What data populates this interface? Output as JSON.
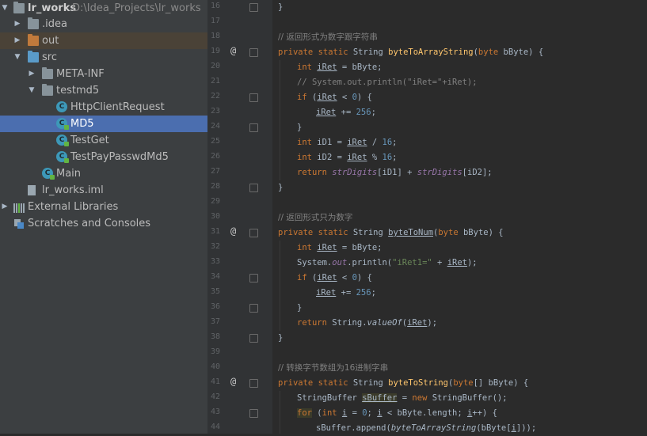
{
  "project_tree": {
    "root": {
      "name": "lr_works",
      "path": "D:\\Idea_Projects\\lr_works"
    },
    "items": [
      {
        "label": "lr_works",
        "extra": "D:\\Idea_Projects\\lr_works",
        "type": "project"
      },
      {
        "label": ".idea",
        "type": "folder"
      },
      {
        "label": "out",
        "type": "folder-orange"
      },
      {
        "label": "src",
        "type": "folder-blue"
      },
      {
        "label": "META-INF",
        "type": "folder"
      },
      {
        "label": "testmd5",
        "type": "package"
      },
      {
        "label": "HttpClientRequest",
        "type": "class"
      },
      {
        "label": "MD5",
        "type": "class",
        "selected": true
      },
      {
        "label": "TestGet",
        "type": "class"
      },
      {
        "label": "TestPayPasswdMd5",
        "type": "class"
      },
      {
        "label": "Main",
        "type": "class"
      },
      {
        "label": "lr_works.iml",
        "type": "file"
      },
      {
        "label": "External Libraries",
        "type": "libraries"
      },
      {
        "label": "Scratches and Consoles",
        "type": "scratches"
      }
    ]
  },
  "gutter": {
    "line_numbers": [
      "16",
      "17",
      "18",
      "19",
      "20",
      "21",
      "22",
      "23",
      "24",
      "25",
      "26",
      "27",
      "28",
      "29",
      "30",
      "31",
      "32",
      "33",
      "34",
      "35",
      "36",
      "37",
      "38",
      "39",
      "40",
      "41",
      "42",
      "43",
      "44"
    ],
    "override_marker": "@"
  },
  "code": {
    "l16": "}",
    "l18_comment": "// 返回形式为数字跟字符串",
    "l19": {
      "kw1": "private",
      "kw2": "static",
      "type": "String",
      "name": "byteToArrayString",
      "ptype": "byte",
      "pname": "bByte",
      "brace": "{"
    },
    "l20": {
      "kw": "int",
      "var": "iRet",
      "rest": " = bByte;"
    },
    "l21": "// System.out.println(\"iRet=\"+iRet);",
    "l22": {
      "kw": "if",
      "var": "iRet",
      "op": " < ",
      "num": "0",
      "rest": ") {"
    },
    "l23": {
      "var": "iRet",
      "op": " += ",
      "num": "256",
      "end": ";"
    },
    "l24": "}",
    "l25": {
      "kw": "int",
      "name": "iD1",
      "var": "iRet",
      "op": " / ",
      "num": "16"
    },
    "l26": {
      "kw": "int",
      "name": "iD2",
      "var": "iRet",
      "op": " % ",
      "num": "16"
    },
    "l27": {
      "kw": "return",
      "field": "strDigits",
      "idx1": "iD1",
      "idx2": "iD2"
    },
    "l28": "}",
    "l30_comment": "// 返回形式只为数字",
    "l31": {
      "kw1": "private",
      "kw2": "static",
      "type": "String",
      "name": "byteToNum",
      "ptype": "byte",
      "pname": "bByte",
      "brace": "{"
    },
    "l32": {
      "kw": "int",
      "var": "iRet",
      "rest": " = bByte;"
    },
    "l33": {
      "a": "System.",
      "out": "out",
      "b": ".println(",
      "str": "\"iRet1=\"",
      "c": " + ",
      "var": "iRet",
      "d": ");"
    },
    "l34": {
      "kw": "if",
      "var": "iRet",
      "op": " < ",
      "num": "0",
      "rest": ") {"
    },
    "l35": {
      "var": "iRet",
      "op": " += ",
      "num": "256",
      "end": ";"
    },
    "l36": "}",
    "l37": {
      "kw": "return",
      "a": "String.",
      "m": "valueOf",
      "var": "iRet",
      "end": ");"
    },
    "l38": "}",
    "l40_comment": "// 转换字节数组为16进制字串",
    "l41": {
      "kw1": "private",
      "kw2": "static",
      "type": "String",
      "name": "byteToString",
      "ptype": "byte",
      "pname": "[] bByte",
      "brace": "{"
    },
    "l42": {
      "type": "StringBuffer",
      "var": "sBuffer",
      "kw": "new",
      "rest": " StringBuffer();"
    },
    "l43": {
      "kw": "for",
      "kw2": "int",
      "var": "i",
      "num": "0",
      "mid": "bByte.length",
      "end": "++) {"
    },
    "l44": {
      "a": "sBuffer.append(",
      "m": "byteToArrayString",
      "b": "(bByte[",
      "var": "i",
      "c": "]));"
    }
  }
}
